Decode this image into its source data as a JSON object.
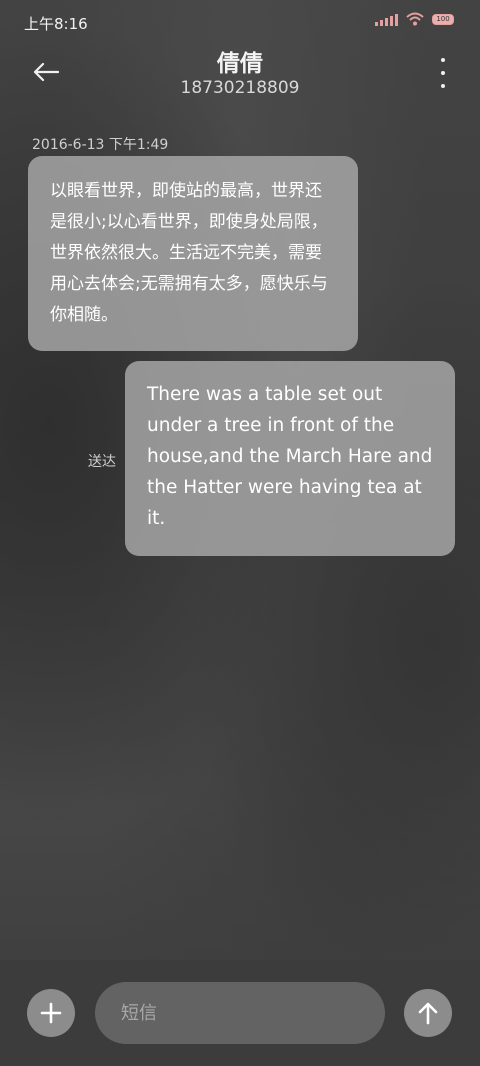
{
  "status_bar": {
    "time": "上午8:16",
    "battery_level": "100",
    "signal_icon": "cellular-signal-icon",
    "wifi_icon": "wifi-icon",
    "battery_icon": "battery-icon"
  },
  "header": {
    "back_icon": "arrow-left-icon",
    "contact_name": "倩倩",
    "contact_number": "18730218809",
    "more_icon": "more-vertical-icon"
  },
  "conversation": {
    "timestamp": "2016-6-13 下午1:49",
    "messages": [
      {
        "direction": "received",
        "text": "以眼看世界，即使站的最高，世界还是很小;以心看世界，即使身处局限，世界依然很大。生活远不完美，需要用心去体会;无需拥有太多，愿快乐与你相随。"
      },
      {
        "direction": "sent",
        "status": "送达",
        "text": "There was a table set out under a tree in front of the house,and the March Hare and the Hatter were having tea at it."
      }
    ]
  },
  "composer": {
    "add_icon": "plus-icon",
    "placeholder": "短信",
    "value": "",
    "send_icon": "arrow-up-icon"
  },
  "colors": {
    "bubble": "#aaaaaa",
    "button": "#8c8c8c",
    "input": "#636363",
    "status_accent": "#e5a0a0"
  }
}
